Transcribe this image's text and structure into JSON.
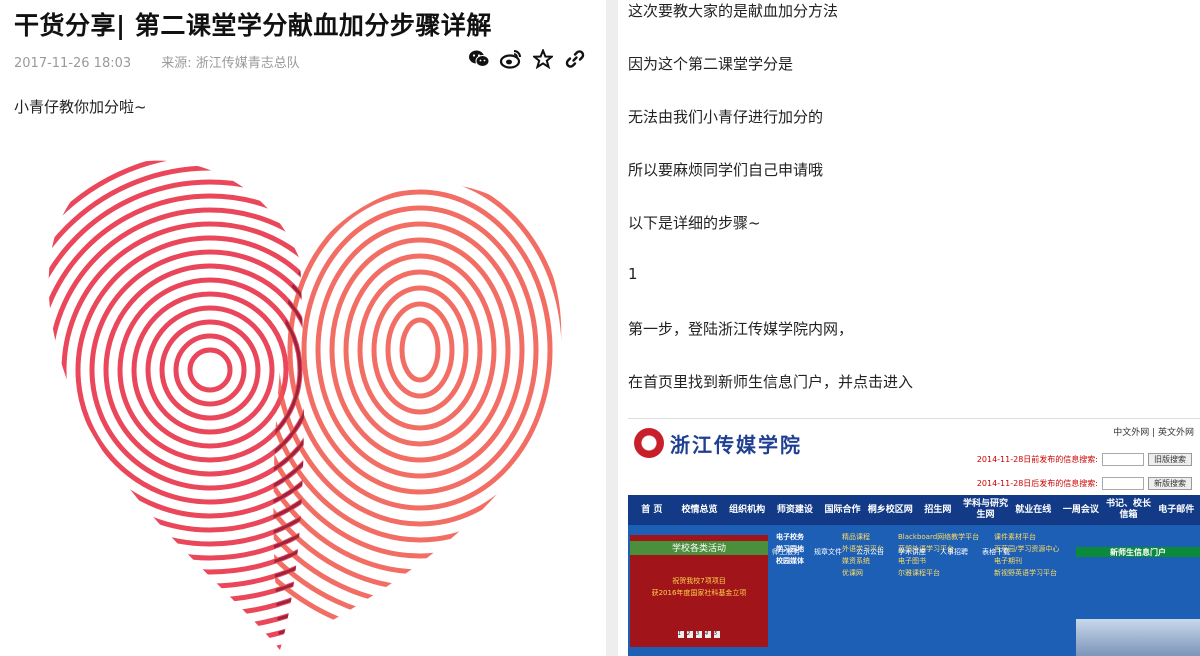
{
  "article": {
    "title": "干货分享| 第二课堂学分献血加分步骤详解",
    "date": "2017-11-26 18:03",
    "source": "来源: 浙江传媒青志总队",
    "lede": "小青仔教你加分啦~",
    "share_icons": [
      "wechat-icon",
      "weibo-icon",
      "star-icon",
      "link-icon"
    ]
  },
  "right": {
    "paragraphs": [
      "这次要教大家的是献血加分方法",
      "因为这个第二课堂学分是",
      "无法由我们小青仔进行加分的",
      "所以要麻烦同学们自己申请哦",
      "以下是详细的步骤~",
      "1",
      "第一步，登陆浙江传媒学院内网，",
      "在首页里找到新师生信息门户，并点击进入"
    ]
  },
  "screenshot": {
    "school_name": "浙江传媒学院",
    "lang_links": "中文外网 | 英文外网",
    "search1": "2014-11-28日前发布的信息搜索:",
    "search1_btn": "旧版搜索",
    "search2": "2014-11-28日后发布的信息搜索:",
    "search2_btn": "新版搜索",
    "nav": [
      "首 页",
      "校情总览",
      "组织机构",
      "师资建设",
      "国际合作",
      "桐乡校区网",
      "招生网",
      "学科与研究生网",
      "就业在线",
      "一周会议",
      "书记、校长信箱",
      "电子邮件"
    ],
    "banner_line1": "祝贺我校7项项目",
    "banner_line2": "获2016年度国家社科基金立项",
    "banner_dots": [
      "1",
      "2",
      "3",
      "4",
      "5"
    ],
    "cats": [
      "电子校务",
      "学习园地",
      "校园媒体"
    ],
    "col1": [
      "精品课程",
      "外语学习平台",
      "媒资系统",
      "优课网"
    ],
    "col2": [
      "Blackboard网络教学平台",
      "蓝鸽外语学习平台",
      "电子图书",
      "尔雅课程平台"
    ],
    "col3": [
      "课件素材平台",
      "百草园/学习资源中心",
      "电子期刊",
      "新视野英语学习平台"
    ],
    "green_bar": "学校各类活动",
    "portal": "新师生信息门户",
    "bottom": [
      "师生服务",
      "规章文件",
      "公示公告",
      "学术讲座",
      "人事招聘",
      "表格下载"
    ]
  },
  "colors": {
    "accent_red": "#e03040",
    "nav_blue": "#123a86"
  }
}
